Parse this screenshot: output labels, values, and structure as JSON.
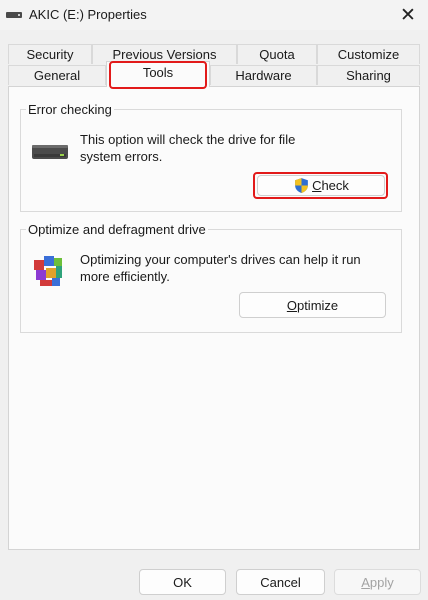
{
  "window": {
    "title": "AKIC (E:) Properties",
    "close_label": "✕"
  },
  "tabs": {
    "row1": [
      "Security",
      "Previous Versions",
      "Quota",
      "Customize"
    ],
    "row2": [
      "General",
      "Tools",
      "Hardware",
      "Sharing"
    ],
    "selected": "Tools"
  },
  "error_checking": {
    "title": "Error checking",
    "description_line1": "This option will check the drive for file",
    "description_line2": "system errors.",
    "button_label_first": "C",
    "button_label_rest": "heck",
    "icon": "drive-icon"
  },
  "optimize": {
    "title": "Optimize and defragment drive",
    "description_line1": "Optimizing your computer's drives can help it run",
    "description_line2": "more efficiently.",
    "button_label_first": "O",
    "button_label_rest": "ptimize",
    "icon": "defrag-icon"
  },
  "footer": {
    "ok": "OK",
    "cancel": "Cancel",
    "apply_first": "A",
    "apply_rest": "pply"
  },
  "colors": {
    "highlight": "#e21a1a",
    "shield_blue": "#2f6fd1",
    "shield_yellow": "#f3c221"
  }
}
